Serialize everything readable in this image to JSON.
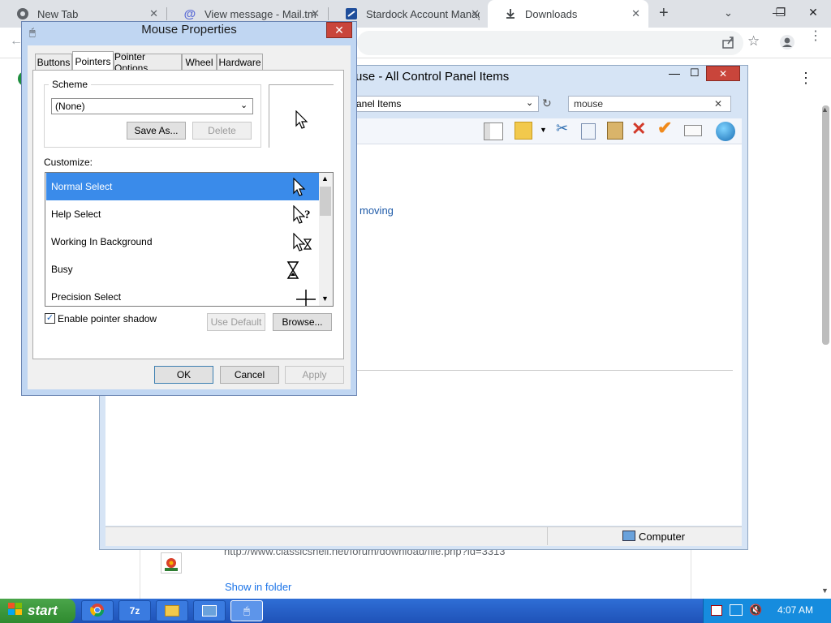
{
  "browser": {
    "tabs": [
      {
        "title": "New Tab",
        "icon": "chrome-icon"
      },
      {
        "title": "View message - Mail.tm",
        "icon": "at-icon"
      },
      {
        "title": "Stardock Account Manag",
        "icon": "stardock-icon"
      },
      {
        "title": "Downloads",
        "icon": "download-icon"
      }
    ],
    "new_tab": "+",
    "downloads": {
      "url": "http://www.classicshell.net/forum/download/file.php?id=3313",
      "show_in_folder": "Show in folder"
    }
  },
  "explorer": {
    "title": "use - All Control Panel Items",
    "address": "anel Items",
    "search_value": "mouse",
    "link_fragment": "moving",
    "status_location": "Computer"
  },
  "mouse_properties": {
    "title": "Mouse Properties",
    "tabs": [
      "Buttons",
      "Pointers",
      "Pointer Options",
      "Wheel",
      "Hardware"
    ],
    "active_tab": "Pointers",
    "scheme_label": "Scheme",
    "scheme_value": "(None)",
    "save_as": "Save As...",
    "delete": "Delete",
    "customize_label": "Customize:",
    "cursors": [
      {
        "name": "Normal Select",
        "icon": "arrow-cursor-icon"
      },
      {
        "name": "Help Select",
        "icon": "help-cursor-icon"
      },
      {
        "name": "Working In Background",
        "icon": "working-cursor-icon"
      },
      {
        "name": "Busy",
        "icon": "hourglass-icon"
      },
      {
        "name": "Precision Select",
        "icon": "crosshair-icon"
      }
    ],
    "shadow_label": "Enable pointer shadow",
    "shadow_checked": "✓",
    "use_default": "Use Default",
    "browse": "Browse...",
    "ok": "OK",
    "cancel": "Cancel",
    "apply": "Apply",
    "close": "✕"
  },
  "taskbar": {
    "start": "start",
    "seven_zip": "7z",
    "clock": "4:07 AM"
  },
  "colors": {
    "selection": "#3a8bea",
    "taskbar": "#1f52b8",
    "close_red": "#c9453b"
  }
}
